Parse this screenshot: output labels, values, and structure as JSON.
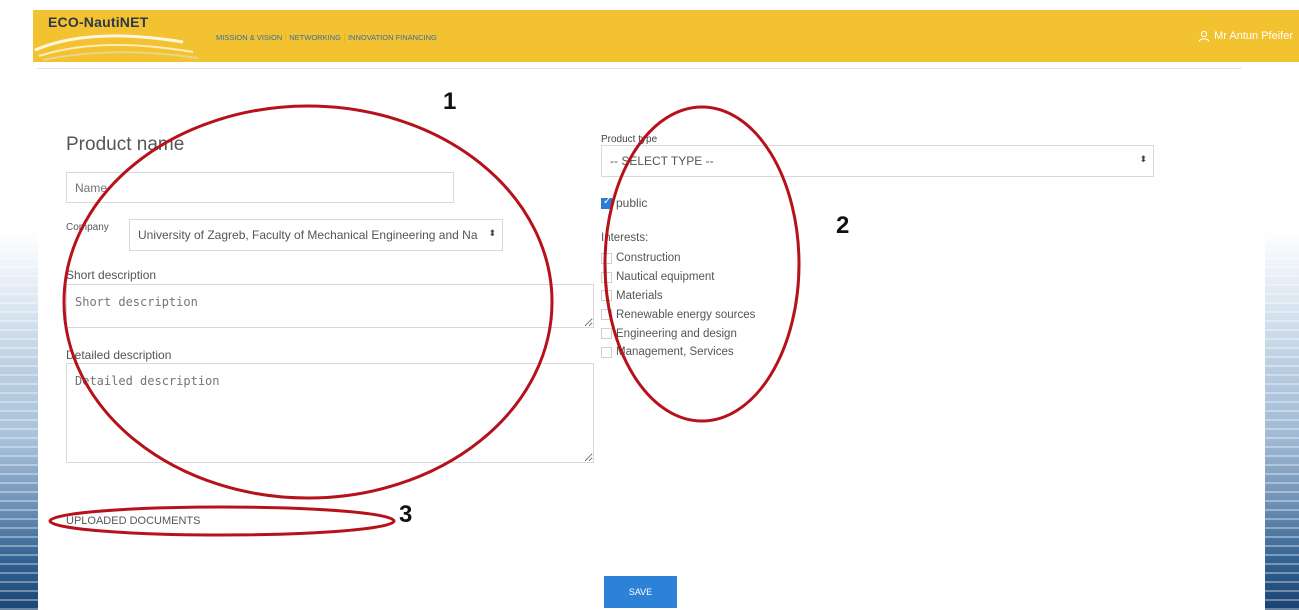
{
  "app": {
    "logo_text": "ECO-NautiNET",
    "nav": [
      "MISSION & VISION",
      "NETWORKING",
      "INNOVATION FINANCING"
    ],
    "user_name": "Mr Antun Pfeifer"
  },
  "annotations": {
    "num1": "1",
    "num2": "2",
    "num3": "3"
  },
  "form": {
    "title": "Product name",
    "name_placeholder": "Name",
    "company_label": "Company",
    "company_value": "University of Zagreb, Faculty of Mechanical Engineering and Na",
    "short_label": "Short description",
    "short_placeholder": "Short description",
    "detail_label": "Detailed description",
    "detail_placeholder": "Detailed description",
    "uploaded_documents": "UPLOADED DOCUMENTS",
    "product_type_label": "Product type",
    "product_type_value": "-- SELECT TYPE --",
    "public_label": "public",
    "public_checked": true,
    "interests_label": "Interests:",
    "interests": [
      "Construction",
      "Nautical equipment",
      "Materials",
      "Renewable energy sources",
      "Engineering and design",
      "Management, Services"
    ],
    "save_label": "SAVE"
  },
  "colors": {
    "header": "#f2c230",
    "nav_link": "#3a6da6",
    "accent": "#2d82d8",
    "annotation": "#b5121b"
  }
}
